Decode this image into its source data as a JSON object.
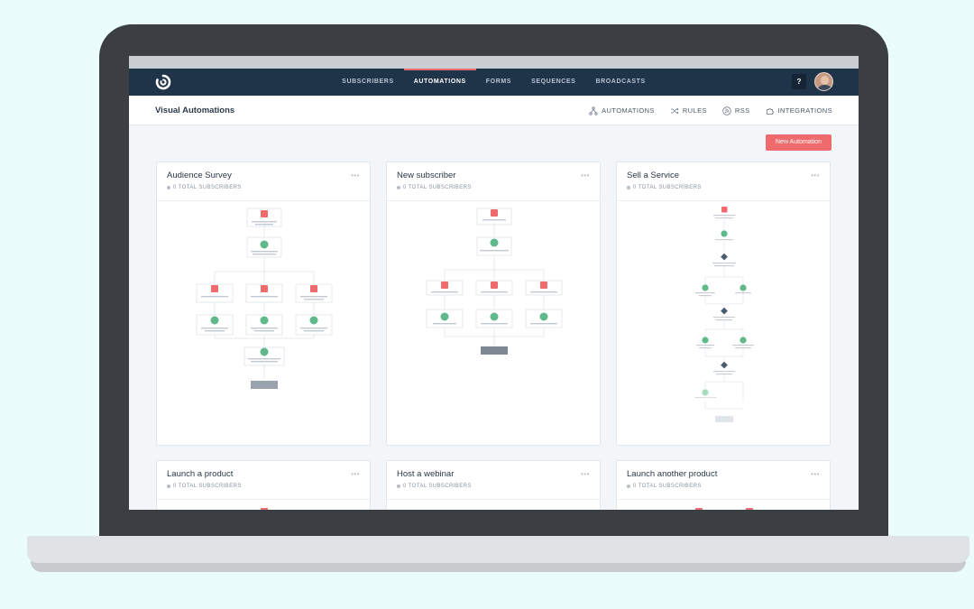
{
  "app": {
    "nav_tabs": [
      {
        "label": "SUBSCRIBERS",
        "active": false
      },
      {
        "label": "AUTOMATIONS",
        "active": true
      },
      {
        "label": "FORMS",
        "active": false
      },
      {
        "label": "SEQUENCES",
        "active": false
      },
      {
        "label": "BROADCASTS",
        "active": false
      }
    ],
    "help_label": "?",
    "page_title": "Visual Automations",
    "subnav": [
      {
        "label": "AUTOMATIONS",
        "icon": "automations-icon"
      },
      {
        "label": "RULES",
        "icon": "shuffle-icon"
      },
      {
        "label": "RSS",
        "icon": "rss-icon"
      },
      {
        "label": "INTEGRATIONS",
        "icon": "puzzle-icon"
      }
    ],
    "new_button": "New Automation",
    "menu_glyph": "•••",
    "colors": {
      "nav": "#1f3349",
      "accent": "#ef6a6c",
      "event_node": "#ef6a6c",
      "action_node": "#5fb98a",
      "condition_node": "#4a5a70"
    }
  },
  "cards": [
    {
      "title": "Audience Survey",
      "subtitle": "0 TOTAL SUBSCRIBERS"
    },
    {
      "title": "New subscriber",
      "subtitle": "0 TOTAL SUBSCRIBERS"
    },
    {
      "title": "Sell a Service",
      "subtitle": "0 TOTAL SUBSCRIBERS"
    },
    {
      "title": "Launch a product",
      "subtitle": "0 TOTAL SUBSCRIBERS"
    },
    {
      "title": "Host a webinar",
      "subtitle": "0 TOTAL SUBSCRIBERS"
    },
    {
      "title": "Launch another product",
      "subtitle": "0 TOTAL SUBSCRIBERS"
    }
  ]
}
